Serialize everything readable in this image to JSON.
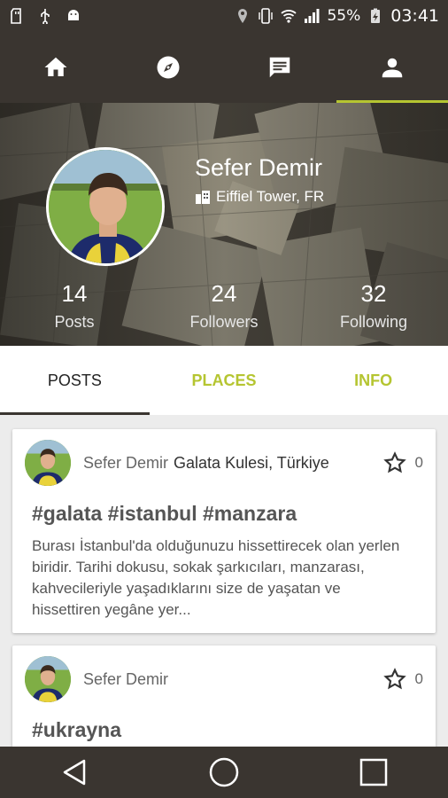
{
  "status_bar": {
    "battery_percent": "55%",
    "time": "03:41",
    "left_icons": [
      "sd-card-icon",
      "usb-icon",
      "android-debug-icon"
    ],
    "right_icons": [
      "location-icon",
      "vibrate-icon",
      "wifi-icon",
      "signal-icon",
      "battery-charging-icon"
    ]
  },
  "app_nav": {
    "items": [
      {
        "icon": "home-icon",
        "active": false
      },
      {
        "icon": "compass-icon",
        "active": false
      },
      {
        "icon": "chat-icon",
        "active": false
      },
      {
        "icon": "person-icon",
        "active": true
      }
    ],
    "accent": "#b5c531"
  },
  "profile": {
    "name": "Sefer Demir",
    "location": "Eiffiel Tower, FR",
    "stats": [
      {
        "value": "14",
        "label": "Posts"
      },
      {
        "value": "24",
        "label": "Followers"
      },
      {
        "value": "32",
        "label": "Following"
      }
    ]
  },
  "tabs": [
    {
      "label": "POSTS",
      "active": true
    },
    {
      "label": "PLACES",
      "active": false
    },
    {
      "label": "INFO",
      "active": false
    }
  ],
  "posts": [
    {
      "author": "Sefer Demir",
      "place": "Galata Kulesi, Türkiye",
      "stars": "0",
      "title": "#galata #istanbul #manzara",
      "text": "Burası İstanbul'da olduğunuzu hissettirecek olan yerlen biridir. Tarihi dokusu, sokak şarkıcıları, manzarası, kahvecileriyle yaşadıklarını size de yaşatan ve hissettiren yegâne yer..."
    },
    {
      "author": "Sefer Demir",
      "place": "",
      "stars": "0",
      "title": "#ukrayna",
      "text": ""
    }
  ],
  "colors": {
    "bar_dark": "#3a3530",
    "accent": "#b5c531",
    "background": "#ececec"
  }
}
